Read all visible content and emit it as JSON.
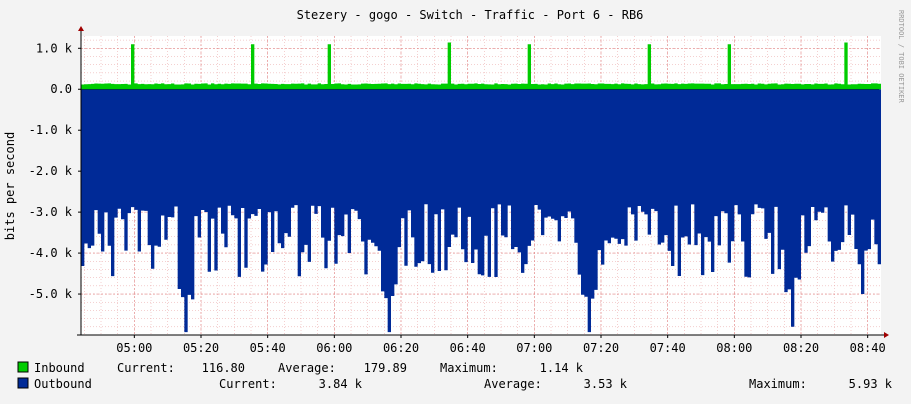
{
  "title": "Stezery - gogo - Switch - Traffic - Port  6 - RB6",
  "watermark": "RRDTOOL / TOBI OETIKER",
  "colors": {
    "background": "#f3f3f3",
    "canvas": "#ffffff",
    "grid": "#e8a0a0",
    "axis": "#000000",
    "inbound": "#00cc00",
    "outbound": "#002a97",
    "arrow": "#a00000"
  },
  "legend": {
    "inbound": {
      "name": "Inbound",
      "current_label": "Current:",
      "current": "116.80",
      "average_label": "Average:",
      "average": "179.89",
      "maximum_label": "Maximum:",
      "maximum": "1.14 k"
    },
    "outbound": {
      "name": "Outbound",
      "current_label": "Current:",
      "current": "3.84 k",
      "average_label": "Average:",
      "average": "3.53 k",
      "maximum_label": "Maximum:",
      "maximum": "5.93 k"
    }
  },
  "chart_data": {
    "type": "area",
    "ylabel": "bits per second",
    "ylim": [
      -6000,
      1300
    ],
    "yticks": [
      {
        "value": 1000,
        "label": "1.0 k"
      },
      {
        "value": 0,
        "label": "0.0"
      },
      {
        "value": -1000,
        "label": "-1.0 k"
      },
      {
        "value": -2000,
        "label": "-2.0 k"
      },
      {
        "value": -3000,
        "label": "-3.0 k"
      },
      {
        "value": -4000,
        "label": "-4.0 k"
      },
      {
        "value": -5000,
        "label": "-5.0 k"
      }
    ],
    "xlim": [
      "04:44",
      "08:44"
    ],
    "xticks": [
      "05:00",
      "05:20",
      "05:40",
      "06:00",
      "06:20",
      "06:40",
      "07:00",
      "07:20",
      "07:40",
      "08:00",
      "08:20",
      "08:40"
    ],
    "grid": true,
    "series": [
      {
        "name": "Inbound",
        "baseline": 130,
        "spikes": [
          {
            "time": "04:59",
            "value": 1100
          },
          {
            "time": "05:35",
            "value": 1100
          },
          {
            "time": "05:58",
            "value": 1100
          },
          {
            "time": "06:34",
            "value": 1140
          },
          {
            "time": "06:58",
            "value": 1100
          },
          {
            "time": "07:34",
            "value": 1100
          },
          {
            "time": "07:58",
            "value": 1100
          },
          {
            "time": "08:33",
            "value": 1140
          }
        ]
      },
      {
        "name": "Outbound",
        "typical_range": [
          -4200,
          -2800
        ],
        "dips": [
          {
            "time": "05:15",
            "value": -5930
          },
          {
            "time": "06:16",
            "value": -5930
          },
          {
            "time": "07:16",
            "value": -5930
          },
          {
            "time": "08:17",
            "value": -5800
          },
          {
            "time": "08:38",
            "value": -5000
          }
        ]
      }
    ]
  }
}
